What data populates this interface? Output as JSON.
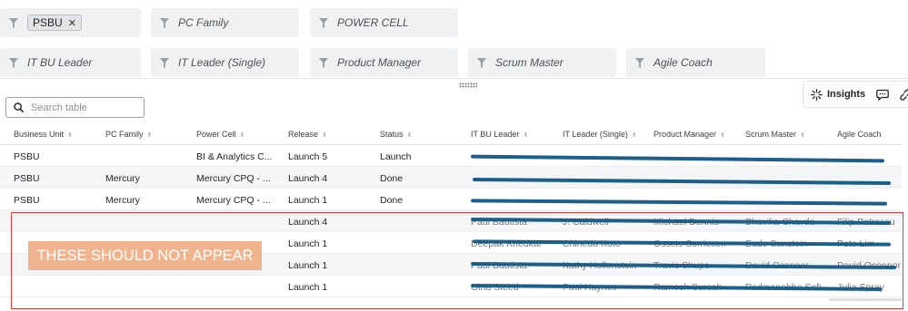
{
  "filters": {
    "business_unit_chip": "PSBU",
    "pc_family": "PC Family",
    "power_cell": "POWER CELL",
    "it_bu_leader": "IT BU Leader",
    "it_leader_single": "IT Leader (Single)",
    "product_manager": "Product Manager",
    "scrum_master": "Scrum Master",
    "agile_coach": "Agile Coach"
  },
  "toolbar": {
    "insights_label": "Insights"
  },
  "search": {
    "placeholder": "Search table"
  },
  "table": {
    "columns": [
      "Business Unit",
      "PC Family",
      "Power Cell",
      "Release",
      "Status",
      "IT BU Leader",
      "IT Leader (Single)",
      "Product Manager",
      "Scrum Master",
      "Agile Coach"
    ],
    "rows": [
      {
        "business_unit": "PSBU",
        "pc_family": "",
        "power_cell": "BI & Analytics C...",
        "release": "Launch 5",
        "status": "Launch"
      },
      {
        "business_unit": "PSBU",
        "pc_family": "Mercury",
        "power_cell": "Mercury CPQ - ...",
        "release": "Launch 4",
        "status": "Done"
      },
      {
        "business_unit": "PSBU",
        "pc_family": "Mercury",
        "power_cell": "Mercury CPQ - ...",
        "release": "Launch 1",
        "status": "Done"
      },
      {
        "business_unit": "",
        "pc_family": "",
        "power_cell": "",
        "release": "Launch 4",
        "status": "",
        "leaders": [
          "Paul Bautista",
          "J. Caldwell",
          "Michael Dennis",
          "Bhavika Chavda",
          "Filip Petrescu"
        ]
      },
      {
        "business_unit": "",
        "pc_family": "",
        "power_cell": "",
        "release": "Launch 1",
        "status": "",
        "leaders": [
          "Deepak Khedkar",
          "Chinedu Koto",
          "Osseis Sorriesen",
          "Eade Sunstein",
          "Pete Lim"
        ]
      },
      {
        "business_unit": "",
        "pc_family": "",
        "power_cell": "",
        "release": "Launch 1",
        "status": "",
        "leaders": [
          "Paul Bautista",
          "Kathy Hollenstein",
          "Travis Shupe",
          "David Oconnor",
          "David Oconnor"
        ]
      },
      {
        "business_unit": "",
        "pc_family": "",
        "power_cell": "",
        "release": "Launch 1",
        "status": "",
        "leaders": [
          "Gina Steed",
          "Paul Haynes",
          "Ramesh Suresh",
          "Padmanabha Sofi",
          "Julia Spray"
        ]
      }
    ]
  },
  "annotation": {
    "callout_text": "THESE SHOULD NOT APPEAR"
  },
  "colors": {
    "redaction": "#1d5f8a",
    "highlight_border": "#e03c3c",
    "callout_bg": "#f0b48e"
  }
}
